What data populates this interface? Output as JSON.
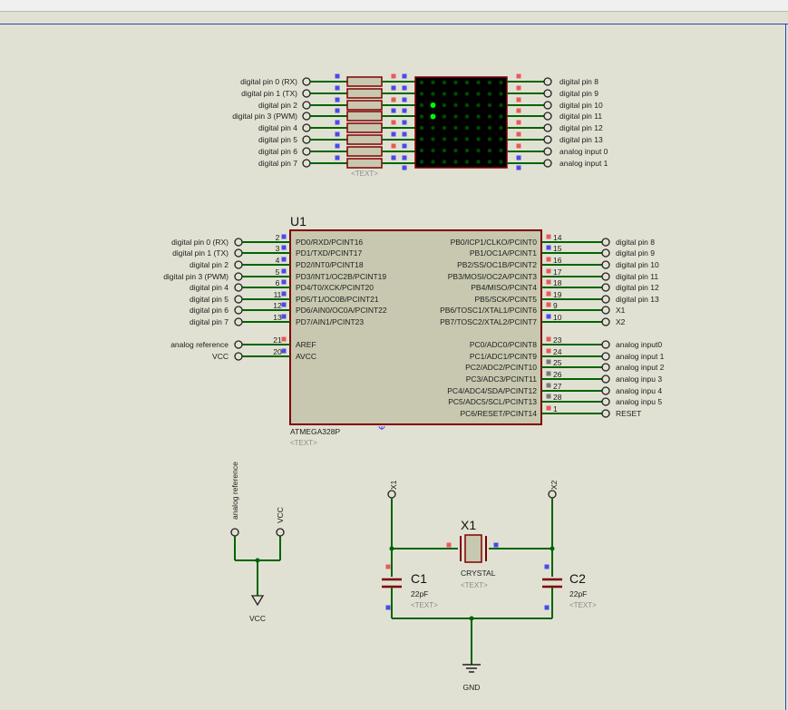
{
  "sheet": {
    "ref_u1": "U1",
    "mcu_part": "ATMEGA328P",
    "text_placeholder": "<TEXT>"
  },
  "left_port_labels": [
    "digital pin 0 (RX)",
    "digital pin 1 (TX)",
    "digital pin 2",
    "digital pin 3 (PWM)",
    "digital pin 4",
    "digital pin 5",
    "digital pin 6",
    "digital pin 7"
  ],
  "matrix_right_labels": [
    "digital pin 8",
    "digital pin 9",
    "digital pin 10",
    "digital pin 11",
    "digital pin 12",
    "digital pin 13",
    "analog input 0",
    "analog input 1"
  ],
  "mcu_left_pins": [
    {
      "num": "2",
      "name": "PD0/RXD/PCINT16",
      "port": "digital pin 0 (RX)"
    },
    {
      "num": "3",
      "name": "PD1/TXD/PCINT17",
      "port": "digital pin 1 (TX)"
    },
    {
      "num": "4",
      "name": "PD2/INT0/PCINT18",
      "port": "digital pin 2"
    },
    {
      "num": "5",
      "name": "PD3/INT1/OC2B/PCINT19",
      "port": "digital pin 3 (PWM)"
    },
    {
      "num": "6",
      "name": "PD4/T0/XCK/PCINT20",
      "port": "digital pin 4"
    },
    {
      "num": "11",
      "name": "PD5/T1/OC0B/PCINT21",
      "port": "digital pin 5"
    },
    {
      "num": "12",
      "name": "PD6/AIN0/OC0A/PCINT22",
      "port": "digital pin 6"
    },
    {
      "num": "13",
      "name": "PD7/AIN1/PCINT23",
      "port": "digital pin 7"
    },
    {
      "num": "21",
      "name": "AREF",
      "port": "analog reference"
    },
    {
      "num": "20",
      "name": "AVCC",
      "port": "VCC"
    }
  ],
  "mcu_right_pins": [
    {
      "num": "14",
      "name": "PB0/ICP1/CLKO/PCINT0",
      "port": "digital pin 8"
    },
    {
      "num": "15",
      "name": "PB1/OC1A/PCINT1",
      "port": "digital pin 9"
    },
    {
      "num": "16",
      "name": "PB2/SS/OC1B/PCINT2",
      "port": "digital pin 10"
    },
    {
      "num": "17",
      "name": "PB3/MOSI/OC2A/PCINT3",
      "port": "digital pin 11"
    },
    {
      "num": "18",
      "name": "PB4/MISO/PCINT4",
      "port": "digital pin 12"
    },
    {
      "num": "19",
      "name": "PB5/SCK/PCINT5",
      "port": "digital pin 13"
    },
    {
      "num": "9",
      "name": "PB6/TOSC1/XTAL1/PCINT6",
      "port": "X1"
    },
    {
      "num": "10",
      "name": "PB7/TOSC2/XTAL2/PCINT7",
      "port": "X2"
    },
    {
      "num": "23",
      "name": "PC0/ADC0/PCINT8",
      "port": "analog input0"
    },
    {
      "num": "24",
      "name": "PC1/ADC1/PCINT9",
      "port": "analog input 1"
    },
    {
      "num": "25",
      "name": "PC2/ADC2/PCINT10",
      "port": "analog input 2"
    },
    {
      "num": "26",
      "name": "PC3/ADC3/PCINT11",
      "port": "analog inpu 3"
    },
    {
      "num": "27",
      "name": "PC4/ADC4/SDA/PCINT12",
      "port": "analog inpu 4"
    },
    {
      "num": "28",
      "name": "PC5/ADC5/SCL/PCINT13",
      "port": "analog inpu 5"
    },
    {
      "num": "1",
      "name": "PC6/RESET/PCINT14",
      "port": "RESET"
    }
  ],
  "vcc_net": {
    "ref_label": "analog reference",
    "vcc_label": "VCC",
    "vcc_bottom": "VCC"
  },
  "crystal": {
    "ref": "X1",
    "value": "CRYSTAL",
    "left_net": "X1",
    "right_net": "X2"
  },
  "c1": {
    "ref": "C1",
    "value": "22pF"
  },
  "c2": {
    "ref": "C2",
    "value": "22pF"
  },
  "gnd_label": "GND",
  "lit_leds": [
    [
      2,
      1
    ],
    [
      3,
      1
    ]
  ],
  "colors": {
    "wire": "#006400",
    "body": "#800000",
    "body_fill": "#c8c8b0",
    "matrix_bg": "#000000",
    "led_on": "#00ff00",
    "led_off": "#004a00",
    "pin_red": "#e85a5a",
    "pin_blue": "#4a4ae8",
    "pin_gray": "#7a7a7a",
    "label": "#202020",
    "ref_text": "#101010",
    "placeholder": "#8a8a8a",
    "sheet": "#2b45b3"
  }
}
